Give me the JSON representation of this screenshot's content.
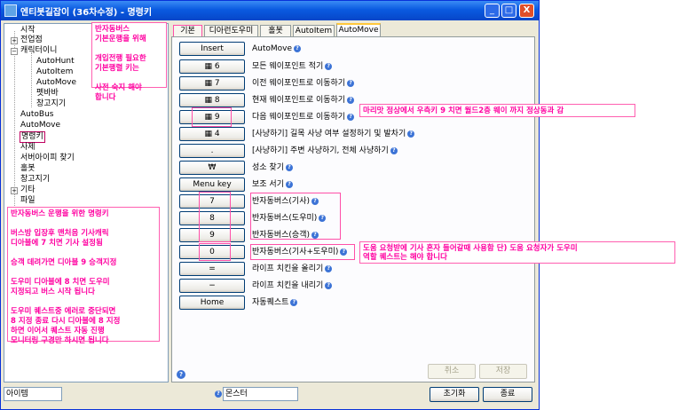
{
  "window": {
    "title": "엔티봇길잡이 (36차수정) - 명령키",
    "minimize": "_",
    "maximize": "□",
    "close": "X"
  },
  "tree": {
    "items": [
      {
        "label": "시작",
        "expander": ""
      },
      {
        "label": "전업점",
        "expander": "+"
      },
      {
        "label": "캐릭터이니",
        "expander": "−"
      },
      {
        "label": "AutoHunt",
        "expander": ""
      },
      {
        "label": "AutoItem",
        "expander": ""
      },
      {
        "label": "AutoMove",
        "expander": ""
      },
      {
        "label": "펫바바",
        "expander": ""
      },
      {
        "label": "창고지기",
        "expander": ""
      },
      {
        "label": "AutoBus",
        "expander": ""
      },
      {
        "label": "AutoMove",
        "expander": ""
      },
      {
        "label": "명령키",
        "expander": ""
      },
      {
        "label": "사제",
        "expander": ""
      },
      {
        "label": "서버아이피 찾기",
        "expander": ""
      },
      {
        "label": "홀봇",
        "expander": ""
      },
      {
        "label": "창고지기",
        "expander": ""
      },
      {
        "label": "기타",
        "expander": "+"
      },
      {
        "label": "파일",
        "expander": ""
      }
    ]
  },
  "notes": {
    "top": "반자동버스\n기본운행을 위해\n\n개입전행 필요한\n기본행렬 키는\n\n사전 숙지 해야\n합니다",
    "bottom": "반자동버스 운행을 위한 명령키\n\n버스방 입장후 맨처음 기사캐릭\n디아블에 7 치면 기사 설정됨\n\n승객 데려가면 디아블 9 승객지정\n\n도우미 디아블에 8 치면 도우미\n지정되고 버스 시작 됩니다\n\n도우미 퀘스트중 에러로 중단되면\n8 지정 종료 다시 디아블에 8 지정\n하면 이어서 퀘스트 자동 진행\n모니터링 구경만 하시면 됩니다",
    "row5": "마리맛 정상에서 우측키 9 치면 월드2층 웨이 까지 정상동과 감",
    "row13": "도움 요청받에 기사 혼자 들어갈때 사용함  단) 도움 요청자가 도우미\n역할 퀘스트는 해야 합니다"
  },
  "tabs": [
    "기본",
    "디아런도우미",
    "홀봇",
    "AutoItem",
    "AutoMove"
  ],
  "rows": [
    {
      "key": "Insert",
      "desc": "AutoMove"
    },
    {
      "key": "▦ 6",
      "desc": "모든 웨이포인트 적기"
    },
    {
      "key": "▦ 7",
      "desc": "이전 웨이포인트로 이동하기"
    },
    {
      "key": "▦ 8",
      "desc": "현재 웨이포인트로 이동하기"
    },
    {
      "key": "▦ 9",
      "desc": "다음 웨이포인트로 이동하기"
    },
    {
      "key": "▦ 4",
      "desc": "[사냥하기] 길목 사냥 여부 설정하기 및 발차기"
    },
    {
      "key": ".",
      "desc": "[사냥하기] 주변 사냥하기, 전체 사냥하기"
    },
    {
      "key": "₩",
      "desc": "성소 찾기"
    },
    {
      "key": "Menu key",
      "desc": "보조 서기"
    },
    {
      "key": "7",
      "desc": "반자동버스(기사)"
    },
    {
      "key": "8",
      "desc": "반자동버스(도우미)"
    },
    {
      "key": "9",
      "desc": "반자동버스(승객)"
    },
    {
      "key": "0",
      "desc": "반자동버스(기사+도우미)"
    },
    {
      "key": "=",
      "desc": "라이프 치킨을 올리기"
    },
    {
      "key": "−",
      "desc": "라이프 치킨을 내리기"
    },
    {
      "key": "Home",
      "desc": "자동퀘스트"
    }
  ],
  "icons": {
    "help": "question-circle-icon"
  },
  "panel_buttons": {
    "cancel": "취소",
    "save": "저장"
  },
  "status": {
    "item_field": "아이템",
    "monster_field": "몬스터",
    "reset_button": "초기화",
    "exit_button": "종료"
  },
  "colors": {
    "note_pink": "#ff00a0",
    "title_blue": "#0a5ae0",
    "xp_beige": "#ece9d8"
  }
}
